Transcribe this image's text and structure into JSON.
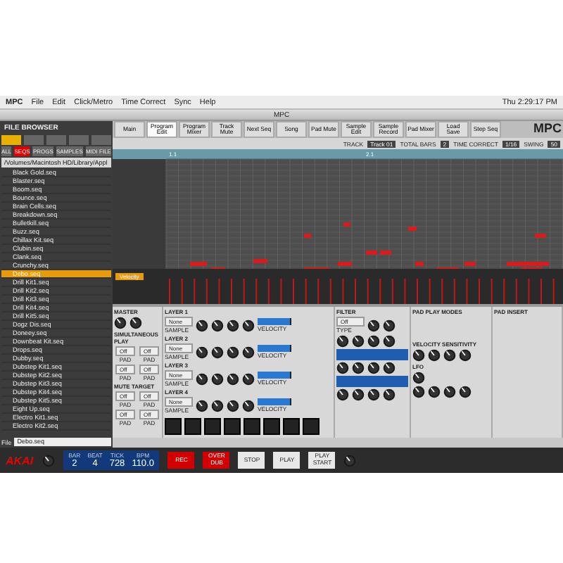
{
  "menu_bar": {
    "app": "MPC",
    "items": [
      "File",
      "Edit",
      "Click/Metro",
      "Time Correct",
      "Sync",
      "Help"
    ],
    "clock": "Thu 2:29:17 PM"
  },
  "window": {
    "title": "MPC"
  },
  "file_browser": {
    "title": "FILE BROWSER",
    "top_buttons": [
      {
        "selected": true
      },
      {
        "selected": false
      },
      {
        "selected": false
      },
      {
        "selected": false
      },
      {
        "selected": false
      }
    ],
    "filter_buttons": [
      {
        "label": "ALL",
        "selected": false
      },
      {
        "label": "SEQS",
        "selected": true
      },
      {
        "label": "PROGS",
        "selected": false
      },
      {
        "label": "SAMPLES",
        "selected": false
      },
      {
        "label": "MIDI FILE",
        "selected": false
      }
    ],
    "path": "/Volumes/Macintosh HD/Library/Appl",
    "files": [
      {
        "name": "Black Gold.seq",
        "selected": false
      },
      {
        "name": "Blaster.seq",
        "selected": false
      },
      {
        "name": "Boom.seq",
        "selected": false
      },
      {
        "name": "Bounce.seq",
        "selected": false
      },
      {
        "name": "Brain Cells.seq",
        "selected": false
      },
      {
        "name": "Breakdown.seq",
        "selected": false
      },
      {
        "name": "Bulletkill.seq",
        "selected": false
      },
      {
        "name": "Buzz.seq",
        "selected": false
      },
      {
        "name": "Chillax Kit.seq",
        "selected": false
      },
      {
        "name": "Clubin.seq",
        "selected": false
      },
      {
        "name": "Clank.seq",
        "selected": false
      },
      {
        "name": "Crunchy.seq",
        "selected": false
      },
      {
        "name": "Debo.seq",
        "selected": true
      },
      {
        "name": "Drill Kit1.seq",
        "selected": false
      },
      {
        "name": "Drill Kit2.seq",
        "selected": false
      },
      {
        "name": "Drill Kit3.seq",
        "selected": false
      },
      {
        "name": "Drill Kit4.seq",
        "selected": false
      },
      {
        "name": "Drill Kit5.seq",
        "selected": false
      },
      {
        "name": "Dogz Dis.seq",
        "selected": false
      },
      {
        "name": "Doneey.seq",
        "selected": false
      },
      {
        "name": "Downbeat Kit.seq",
        "selected": false
      },
      {
        "name": "Drops.seq",
        "selected": false
      },
      {
        "name": "Dubby.seq",
        "selected": false
      },
      {
        "name": "Dubstep Kit1.seq",
        "selected": false
      },
      {
        "name": "Dubstep Kit2.seq",
        "selected": false
      },
      {
        "name": "Dubstep Kit3.seq",
        "selected": false
      },
      {
        "name": "Dubstep Kit4.seq",
        "selected": false
      },
      {
        "name": "Dubstep Kit5.seq",
        "selected": false
      },
      {
        "name": "Eight Up.seq",
        "selected": false
      },
      {
        "name": "Electro Kit1.seq",
        "selected": false
      },
      {
        "name": "Electro Kit2.seq",
        "selected": false
      }
    ],
    "file_field": {
      "label": "File",
      "value": "Debo.seq"
    }
  },
  "tabs": [
    {
      "label": "Main",
      "selected": false
    },
    {
      "label": "Program Edit",
      "selected": true
    },
    {
      "label": "Program Mixer",
      "selected": false
    },
    {
      "label": "Track Mute",
      "selected": false
    },
    {
      "label": "Next Seq",
      "selected": false
    },
    {
      "label": "Song",
      "selected": false
    },
    {
      "label": "Pad Mute",
      "selected": false
    },
    {
      "label": "Sample Edit",
      "selected": false
    },
    {
      "label": "Sample Record",
      "selected": false
    },
    {
      "label": "Pad Mixer",
      "selected": false
    },
    {
      "label": "Load Save",
      "selected": false
    },
    {
      "label": "Step Seq",
      "selected": false
    }
  ],
  "toolbar": {
    "logo": "MPC",
    "fields": [
      {
        "label": "TRACK",
        "value": "Track 01"
      },
      {
        "label": "TOTAL BARS",
        "value": "2"
      },
      {
        "label": "TIME CORRECT",
        "value": "1/16"
      },
      {
        "label": "SWING",
        "value": "50"
      }
    ]
  },
  "piano_roll": {
    "ruler": [
      "1.1",
      "2.1"
    ],
    "lane": "Velocity"
  },
  "master": {
    "title": "MASTER"
  },
  "layers": [
    {
      "title": "LAYER 1",
      "sample": "None",
      "sample_label": "SAMPLE",
      "velocity_label": "VELOCITY",
      "level": 0.95
    },
    {
      "title": "LAYER 2",
      "sample": "None",
      "sample_label": "SAMPLE",
      "velocity_label": "VELOCITY",
      "level": 0.95
    },
    {
      "title": "LAYER 3",
      "sample": "None",
      "sample_label": "SAMPLE",
      "velocity_label": "VELOCITY",
      "level": 0.95
    },
    {
      "title": "LAYER 4",
      "sample": "None",
      "sample_label": "SAMPLE",
      "velocity_label": "VELOCITY",
      "level": 0.95
    }
  ],
  "filter": {
    "title": "FILTER",
    "type": "Off",
    "type_label": "TYPE"
  },
  "pad_play_modes": {
    "title": "PAD PLAY MODES"
  },
  "velocity_sensitivity": {
    "title": "VELOCITY SENSITIVITY"
  },
  "lfo": {
    "title": "LFO"
  },
  "pad_insert": {
    "title": "PAD INSERT"
  },
  "simultaneous_play": {
    "title": "SIMULTANEOUS PLAY",
    "slots": [
      {
        "value": "Off",
        "label": "PAD"
      },
      {
        "value": "Off",
        "label": "PAD"
      },
      {
        "value": "Off",
        "label": "PAD"
      },
      {
        "value": "Off",
        "label": "PAD"
      }
    ]
  },
  "mute_target": {
    "title": "MUTE TARGET",
    "slots": [
      {
        "value": "Off",
        "label": "PAD"
      },
      {
        "value": "Off",
        "label": "PAD"
      },
      {
        "value": "Off",
        "label": "PAD"
      },
      {
        "value": "Off",
        "label": "PAD"
      }
    ]
  },
  "transport": {
    "logo": "AKAI",
    "display": [
      {
        "label": "BAR",
        "value": "2"
      },
      {
        "label": "BEAT",
        "value": "4"
      },
      {
        "label": "TICK",
        "value": "728"
      },
      {
        "label": "BPM",
        "value": "110.0"
      }
    ],
    "buttons": [
      {
        "label": "REC",
        "kind": "red"
      },
      {
        "label": "OVER DUB",
        "kind": "red"
      },
      {
        "label": "STOP",
        "kind": "plain"
      },
      {
        "label": "PLAY",
        "kind": "plain"
      },
      {
        "label": "PLAY START",
        "kind": "plain"
      }
    ]
  }
}
